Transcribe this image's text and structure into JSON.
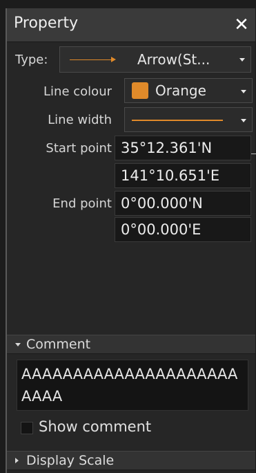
{
  "panel": {
    "title": "Property",
    "close_icon": "close-icon"
  },
  "type": {
    "label": "Type:",
    "value": "Arrow(St...",
    "preview_icon": "arrow-line-icon"
  },
  "line_colour": {
    "label": "Line colour",
    "value": "Orange",
    "swatch_color": "#e08a2a"
  },
  "line_width": {
    "label": "Line width",
    "preview_color": "#e08a2a"
  },
  "start_point": {
    "label": "Start point",
    "lat": "35°12.361'N",
    "lon": "141°10.651'E"
  },
  "end_point": {
    "label": "End point",
    "lat": "0°00.000'N",
    "lon": "0°00.000'E"
  },
  "comment": {
    "header": "Comment",
    "text": "AAAAAAAAAAAAAAAAAAAAAAAAA",
    "show_label": "Show comment",
    "show_checked": false
  },
  "display_scale": {
    "header": "Display Scale"
  }
}
